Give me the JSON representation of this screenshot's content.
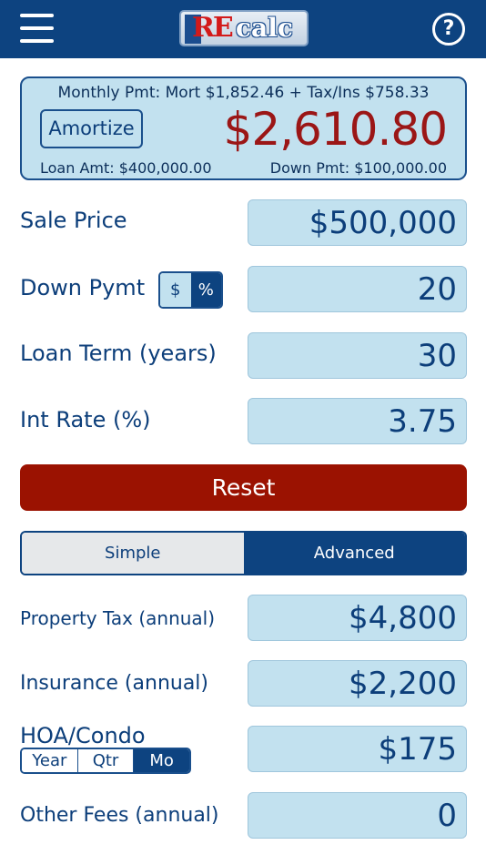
{
  "header": {
    "logo_re": "RE",
    "logo_calc": "calc",
    "help_glyph": "?"
  },
  "summary": {
    "monthly_line": "Monthly Pmt: Mort $1,852.46 + Tax/Ins $758.33",
    "amortize_label": "Amortize",
    "total": "$2,610.80",
    "loan_amt": "Loan Amt: $400,000.00",
    "down_pmt": "Down Pmt: $100,000.00"
  },
  "fields": {
    "sale_price": {
      "label": "Sale Price",
      "value": "$500,000"
    },
    "down_pymt": {
      "label": "Down Pymt",
      "value": "20",
      "toggle": [
        "$",
        "%"
      ],
      "selected": "%"
    },
    "loan_term": {
      "label": "Loan Term (years)",
      "value": "30"
    },
    "int_rate": {
      "label": "Int Rate (%)",
      "value": "3.75"
    }
  },
  "reset_label": "Reset",
  "mode_tabs": {
    "simple": "Simple",
    "advanced": "Advanced",
    "selected": "Advanced"
  },
  "advanced": {
    "property_tax": {
      "label": "Property Tax (annual)",
      "value": "$4,800"
    },
    "insurance": {
      "label": "Insurance (annual)",
      "value": "$2,200"
    },
    "hoa": {
      "label": "HOA/Condo",
      "value": "$175",
      "periods": [
        "Year",
        "Qtr",
        "Mo"
      ],
      "selected": "Mo"
    },
    "other_fees": {
      "label": "Other Fees (annual)",
      "value": "0"
    }
  },
  "icons": {
    "menu": "menu-icon",
    "help": "help-icon"
  },
  "colors": {
    "header": "#0d4380",
    "field_bg": "#c2e1ef",
    "total": "#9b1616",
    "reset": "#9b1201",
    "text": "#0c3e7a"
  }
}
